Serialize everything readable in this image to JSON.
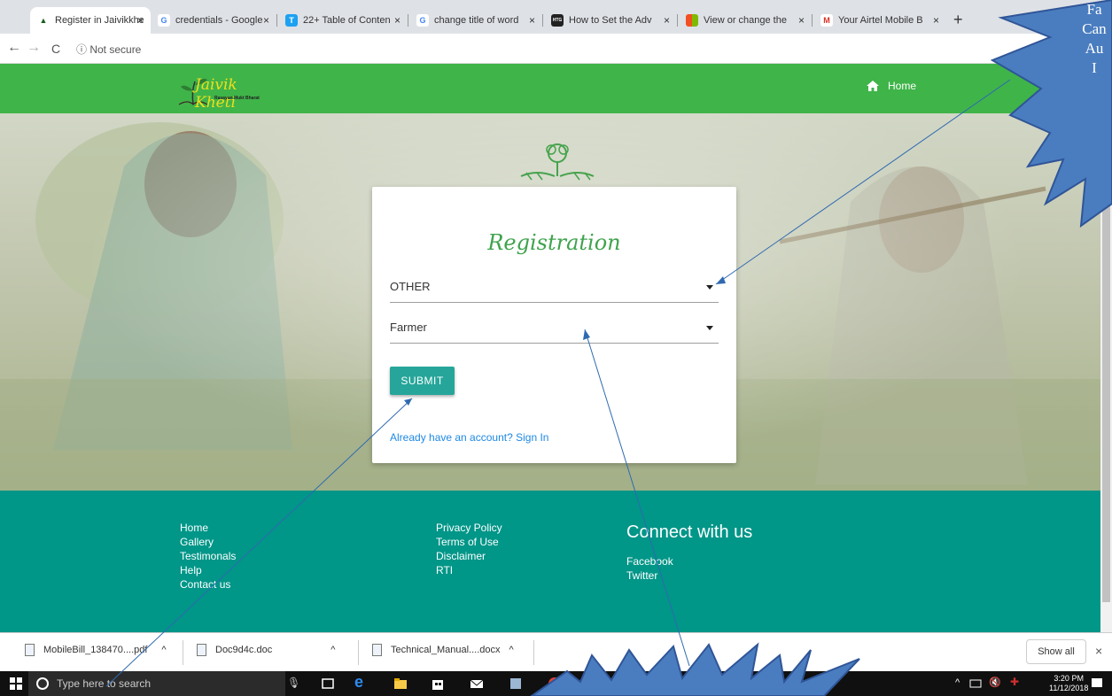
{
  "browser": {
    "tabs": [
      {
        "label": "Register in Jaivikkhe",
        "favicon": "jk",
        "color": "#1b5e20"
      },
      {
        "label": "credentials - Google",
        "favicon": "G",
        "color": "#4285f4"
      },
      {
        "label": "22+ Table of Conten",
        "favicon": "T",
        "color": "#1da1f2"
      },
      {
        "label": "change title of word",
        "favicon": "G",
        "color": "#4285f4"
      },
      {
        "label": "How to Set the Adv",
        "favicon": "HTG",
        "color": "#222222"
      },
      {
        "label": "View or change the",
        "favicon": "ms",
        "color": "#f25022"
      },
      {
        "label": "Your Airtel Mobile B",
        "favicon": "M",
        "color": "#d93025"
      }
    ],
    "close_glyph": "×",
    "new_tab_glyph": "+",
    "back_glyph": "←",
    "forward_glyph": "→",
    "reload_glyph": "C",
    "security_label": "ⓘ Not secure"
  },
  "site": {
    "logo_text": "Jaivik Kheti",
    "logo_tagline": "Rasayan Mukt Bharat",
    "nav_home": "Home",
    "registration": {
      "title": "Registration",
      "select1_value": "OTHER",
      "select2_value": "Farmer",
      "submit_label": "SUBMIT",
      "signin_link": "Already have an account? Sign In"
    },
    "footer": {
      "col1": [
        "Home",
        "Gallery",
        "Testimonals",
        "Help",
        "Contact us"
      ],
      "col2": [
        "Privacy Policy",
        "Terms of Use",
        "Disclaimer",
        "RTI"
      ],
      "connect_title": "Connect with us",
      "col3": [
        "Facebook",
        "Twitter"
      ]
    }
  },
  "downloads": {
    "items": [
      "MobileBill_138470....pdf",
      "Doc9d4c.doc",
      "Technical_Manual....docx"
    ],
    "chevron_glyph": "^",
    "show_all": "Show all",
    "close_glyph": "×"
  },
  "taskbar": {
    "search_placeholder": "Type here to search",
    "time": "3:20 PM",
    "date": "11/12/2018"
  },
  "callout": {
    "lines": [
      "Fa",
      "Can",
      "Au",
      "I"
    ],
    "fill": "#4a7dc0"
  },
  "colors": {
    "header_green": "#3fb449",
    "footer_teal": "#009688",
    "button_teal": "#26a69a",
    "title_green": "#3fa34d",
    "link_blue": "#1e88e5"
  }
}
